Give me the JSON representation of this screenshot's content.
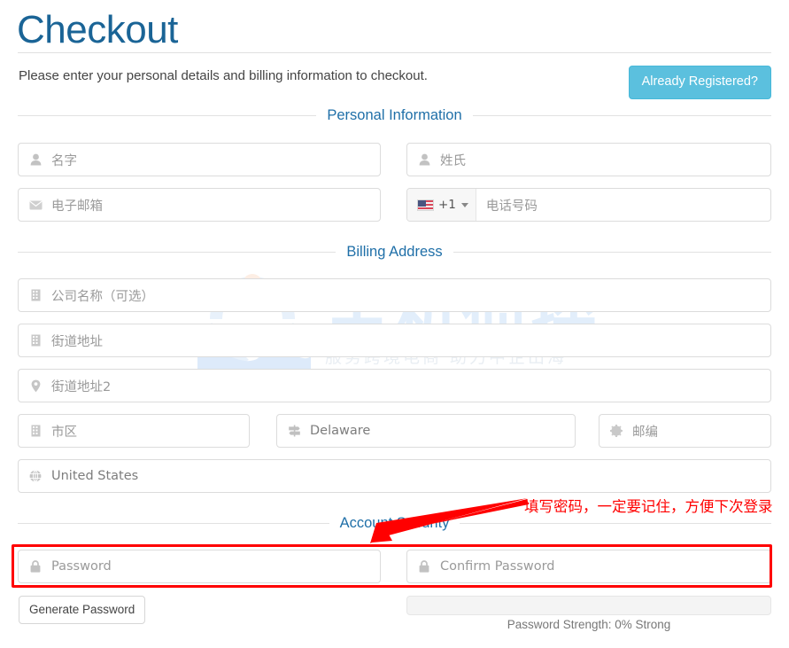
{
  "header": {
    "title": "Checkout",
    "intro": "Please enter your personal details and billing information to checkout.",
    "registered_button": "Already Registered?"
  },
  "watermark": {
    "main_text": "主机侦探",
    "sub_text": "服务跨境电商  助力中企出海"
  },
  "sections": {
    "personal": {
      "label": "Personal Information"
    },
    "billing": {
      "label": "Billing Address"
    },
    "security": {
      "label": "Account Security"
    }
  },
  "fields": {
    "first_name": {
      "placeholder": "名字",
      "icon": "user-icon"
    },
    "last_name": {
      "placeholder": "姓氏",
      "icon": "user-icon"
    },
    "email": {
      "placeholder": "电子邮箱",
      "icon": "envelope-icon"
    },
    "phone": {
      "placeholder": "电话号码",
      "icon": "flag-icon",
      "dial_code": "+1",
      "flag": "us-flag-icon"
    },
    "company": {
      "placeholder": "公司名称（可选）",
      "icon": "building-icon"
    },
    "address1": {
      "placeholder": "街道地址",
      "icon": "building-icon"
    },
    "address2": {
      "placeholder": "街道地址2",
      "icon": "map-pin-icon"
    },
    "city": {
      "placeholder": "市区",
      "icon": "building-icon"
    },
    "state": {
      "value": "Delaware",
      "icon": "signpost-icon"
    },
    "zip": {
      "placeholder": "邮编",
      "icon": "circle-dots-icon"
    },
    "country": {
      "value": "United States",
      "icon": "globe-icon"
    },
    "password": {
      "placeholder": "Password",
      "icon": "lock-icon"
    },
    "confirm_password": {
      "placeholder": "Confirm Password",
      "icon": "lock-icon"
    }
  },
  "password_tools": {
    "generate_button": "Generate Password",
    "strength_text": "Password Strength: 0% Strong",
    "strength_percent": 0
  },
  "annotation": {
    "text": "填写密码，一定要记住，方便下次登录",
    "color": "#ff0000"
  },
  "colors": {
    "heading": "#1a6496",
    "section_label": "#1f6fa8",
    "info_button": "#5bc0de",
    "annotation": "#ff0000"
  }
}
